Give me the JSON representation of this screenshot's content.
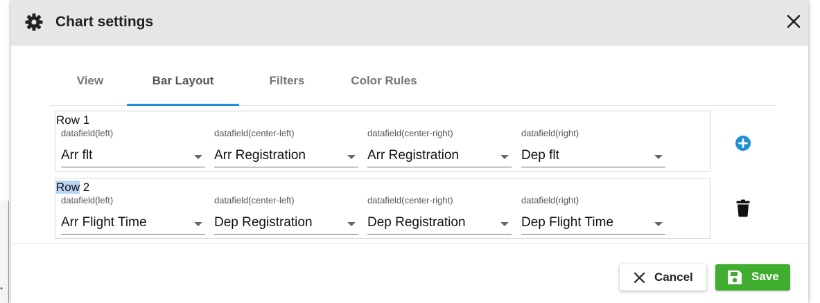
{
  "dialog": {
    "title": "Chart settings",
    "header_icon": "gear-icon",
    "close_icon": "close-icon"
  },
  "tabs": [
    {
      "label": "View",
      "active": false
    },
    {
      "label": "Bar Layout",
      "active": true
    },
    {
      "label": "Filters",
      "active": false
    },
    {
      "label": "Color Rules",
      "active": false
    }
  ],
  "rows": [
    {
      "title_highlight": "Row",
      "title_rest": " 1",
      "fields": [
        {
          "label": "datafield(left)",
          "value": "Arr flt"
        },
        {
          "label": "datafield(center-left)",
          "value": "Arr Registration"
        },
        {
          "label": "datafield(center-right)",
          "value": "Arr Registration"
        },
        {
          "label": "datafield(right)",
          "value": "Dep flt"
        }
      ]
    },
    {
      "title_highlight": "Row",
      "title_rest": " 2",
      "fields": [
        {
          "label": "datafield(left)",
          "value": "Arr Flight Time"
        },
        {
          "label": "datafield(center-left)",
          "value": "Dep Registration"
        },
        {
          "label": "datafield(center-right)",
          "value": "Dep Registration"
        },
        {
          "label": "datafield(right)",
          "value": "Dep Flight Time"
        }
      ]
    }
  ],
  "actions": {
    "add_row_icon": "plus-circle-icon",
    "delete_row_icon": "trash-icon",
    "cancel_label": "Cancel",
    "save_label": "Save"
  },
  "colors": {
    "accent": "#1f8fd6",
    "save_green": "#3fad2e",
    "header_bg": "#e6e6e6",
    "selection_highlight": "#b9d3f3"
  }
}
